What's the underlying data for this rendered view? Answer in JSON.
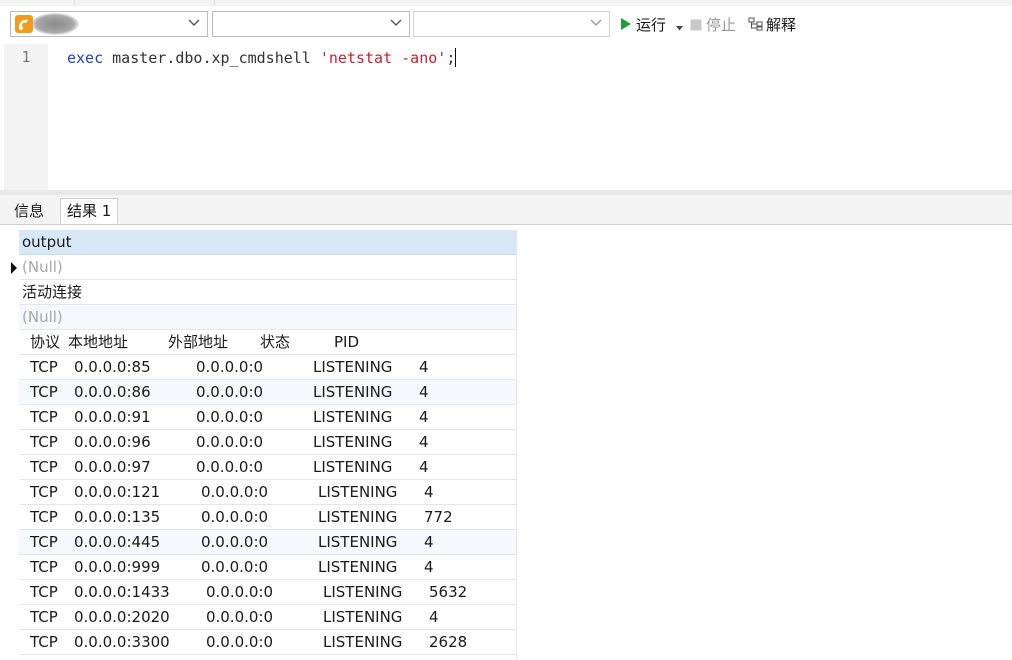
{
  "toolbar": {
    "run_label": "运行",
    "stop_label": "停止",
    "explain_label": "解释"
  },
  "editor": {
    "line_number": "1",
    "code": {
      "keyword": "exec",
      "proc": " master.dbo.xp_cmdshell ",
      "string": "'netstat -ano'",
      "terminator": ";"
    }
  },
  "tabs": [
    {
      "label": "信息"
    },
    {
      "label": "结果 1"
    }
  ],
  "grid": {
    "column": "output",
    "null_text": "(Null)",
    "active_connections": "活动连接",
    "header_row": {
      "proto": "协议",
      "local": "本地地址",
      "foreign": "外部地址",
      "state": "状态",
      "pid": "PID"
    },
    "rows": [
      {
        "proto": "TCP",
        "local": "0.0.0.0:85",
        "foreign": "0.0.0.0:0",
        "state": "LISTENING",
        "pid": "4"
      },
      {
        "proto": "TCP",
        "local": "0.0.0.0:86",
        "foreign": "0.0.0.0:0",
        "state": "LISTENING",
        "pid": "4"
      },
      {
        "proto": "TCP",
        "local": "0.0.0.0:91",
        "foreign": "0.0.0.0:0",
        "state": "LISTENING",
        "pid": "4"
      },
      {
        "proto": "TCP",
        "local": "0.0.0.0:96",
        "foreign": "0.0.0.0:0",
        "state": "LISTENING",
        "pid": "4"
      },
      {
        "proto": "TCP",
        "local": "0.0.0.0:97",
        "foreign": "0.0.0.0:0",
        "state": "LISTENING",
        "pid": "4"
      },
      {
        "proto": "TCP",
        "local": "0.0.0.0:121",
        "foreign": "0.0.0.0:0",
        "state": "LISTENING",
        "pid": "4"
      },
      {
        "proto": "TCP",
        "local": "0.0.0.0:135",
        "foreign": "0.0.0.0:0",
        "state": "LISTENING",
        "pid": "772"
      },
      {
        "proto": "TCP",
        "local": "0.0.0.0:445",
        "foreign": "0.0.0.0:0",
        "state": "LISTENING",
        "pid": "4"
      },
      {
        "proto": "TCP",
        "local": "0.0.0.0:999",
        "foreign": "0.0.0.0:0",
        "state": "LISTENING",
        "pid": "4"
      },
      {
        "proto": "TCP",
        "local": "0.0.0.0:1433",
        "foreign": "0.0.0.0:0",
        "state": "LISTENING",
        "pid": "5632"
      },
      {
        "proto": "TCP",
        "local": "0.0.0.0:2020",
        "foreign": "0.0.0.0:0",
        "state": "LISTENING",
        "pid": "4"
      },
      {
        "proto": "TCP",
        "local": "0.0.0.0:3300",
        "foreign": "0.0.0.0:0",
        "state": "LISTENING",
        "pid": "2628"
      }
    ]
  },
  "colors": {
    "accent": "#1f9d3a",
    "header_bg": "#d9e8f7",
    "keyword": "#1f3fd0",
    "string": "#c8202e"
  }
}
